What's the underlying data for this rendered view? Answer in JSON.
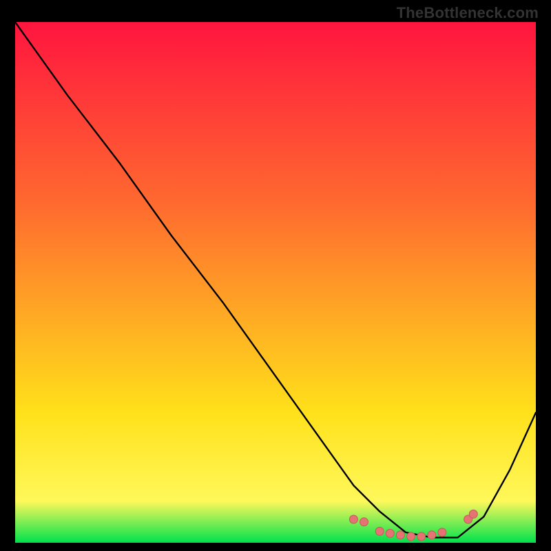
{
  "watermark": "TheBottleneck.com",
  "colors": {
    "bg": "#000000",
    "grad_top": "#ff153f",
    "grad_mid": "#ffe11a",
    "grad_bottom": "#00e24d",
    "curve": "#000000",
    "dot_fill": "#e57373",
    "dot_stroke": "#c45a5a"
  },
  "chart_data": {
    "type": "line",
    "title": "",
    "xlabel": "",
    "ylabel": "",
    "xlim": [
      0,
      100
    ],
    "ylim": [
      0,
      100
    ],
    "series": [
      {
        "name": "bottleneck-curve",
        "x": [
          0,
          10,
          20,
          30,
          40,
          50,
          60,
          65,
          70,
          75,
          80,
          85,
          90,
          95,
          100
        ],
        "values": [
          100,
          86,
          73,
          59,
          46,
          32,
          18,
          11,
          6,
          2,
          1,
          1,
          5,
          14,
          25
        ]
      }
    ],
    "marker_cluster": {
      "name": "highlight-dots",
      "points": [
        {
          "x": 65,
          "y": 4.5
        },
        {
          "x": 67,
          "y": 4.0
        },
        {
          "x": 70,
          "y": 2.2
        },
        {
          "x": 72,
          "y": 1.8
        },
        {
          "x": 74,
          "y": 1.5
        },
        {
          "x": 76,
          "y": 1.2
        },
        {
          "x": 78,
          "y": 1.2
        },
        {
          "x": 80,
          "y": 1.5
        },
        {
          "x": 82,
          "y": 2.0
        },
        {
          "x": 87,
          "y": 4.5
        },
        {
          "x": 88,
          "y": 5.5
        }
      ]
    }
  }
}
